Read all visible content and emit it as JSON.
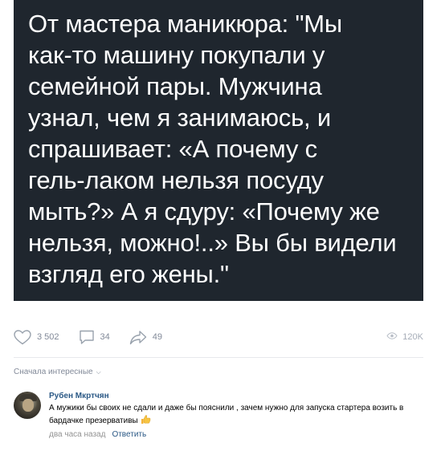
{
  "post": {
    "quote_text": "От мастера маникюра: \"Мы\nкак-то машину покупали у\nсемейной пары. Мужчина\nузнал, чем я занимаюсь, и\nспрашивает: «А почему с\nгель-лаком нельзя посуду\nмыть?» А я сдуру: «Почему же\nнельзя, можно!..» Вы бы видели\nвзгляд его жены.\"",
    "colors": {
      "card_bg": "#1f262e",
      "card_text": "#ffffff",
      "link": "#2a5885",
      "muted": "#828a99"
    }
  },
  "actions": {
    "likes": "3 502",
    "comments": "34",
    "shares": "49",
    "views": "120K",
    "icons": [
      "heart-icon",
      "comment-icon",
      "share-icon",
      "eye-icon"
    ]
  },
  "comments_section": {
    "sort_label": "Сначала интересные",
    "items": [
      {
        "author": "Рубен Мкртчян",
        "text": "А мужики бы своих не сдали и даже бы пояснили , зачем нужно для запуска стартера возить в бардачке презервативы",
        "emoji": "thumbs-up-icon",
        "time": "два часа назад",
        "reply_label": "Ответить"
      }
    ]
  }
}
